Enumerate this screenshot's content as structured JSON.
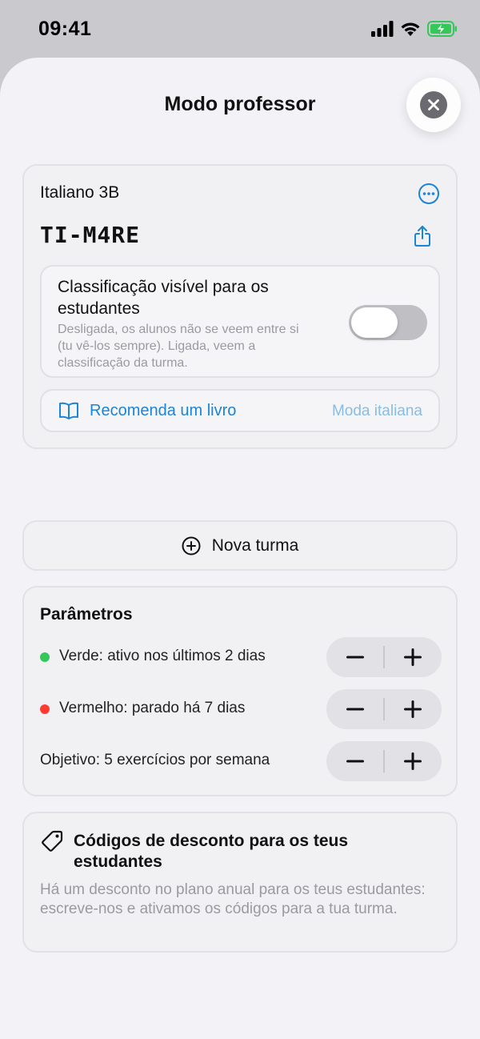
{
  "status_bar": {
    "time": "09:41",
    "icons": [
      "cellular-signal-icon",
      "wifi-icon",
      "battery-charging-icon"
    ]
  },
  "sheet": {
    "title": "Modo professor",
    "close_icon": "close-icon"
  },
  "class_card": {
    "name": "Italiano 3B",
    "code": "TI-M4RE",
    "more_icon": "ellipsis-circle-icon",
    "share_icon": "share-icon",
    "ranking": {
      "title": "Classificação visível para os estudantes",
      "description": "Desligada, os alunos não se veem entre si (tu vê-los sempre). Ligada, veem a classificação da turma.",
      "enabled": false
    },
    "book": {
      "icon": "book-icon",
      "label": "Recomenda um livro",
      "subject": "Moda italiana"
    }
  },
  "new_class": {
    "icon": "plus-circle-icon",
    "label": "Nova turma"
  },
  "parameters": {
    "title": "Parâmetros",
    "rows": [
      {
        "text": "Verde: ativo nos últimos 2 dias",
        "dot_color": "#34c759"
      },
      {
        "text": "Vermelho: parado há 7 dias",
        "dot_color": "#ff3b30"
      },
      {
        "text": "Objetivo: 5 exercícios por semana",
        "dot_color": null
      }
    ]
  },
  "discount": {
    "icon": "tag-icon",
    "title": "Códigos de desconto para os teus estudantes",
    "body": "Há um desconto no plano anual para os teus estudantes: escreve-nos e ativamos os códigos para a tua turma."
  },
  "colors": {
    "accent": "#1a84d6",
    "accent_light": "#86bde6",
    "green": "#34c759",
    "red": "#ff3b30"
  }
}
